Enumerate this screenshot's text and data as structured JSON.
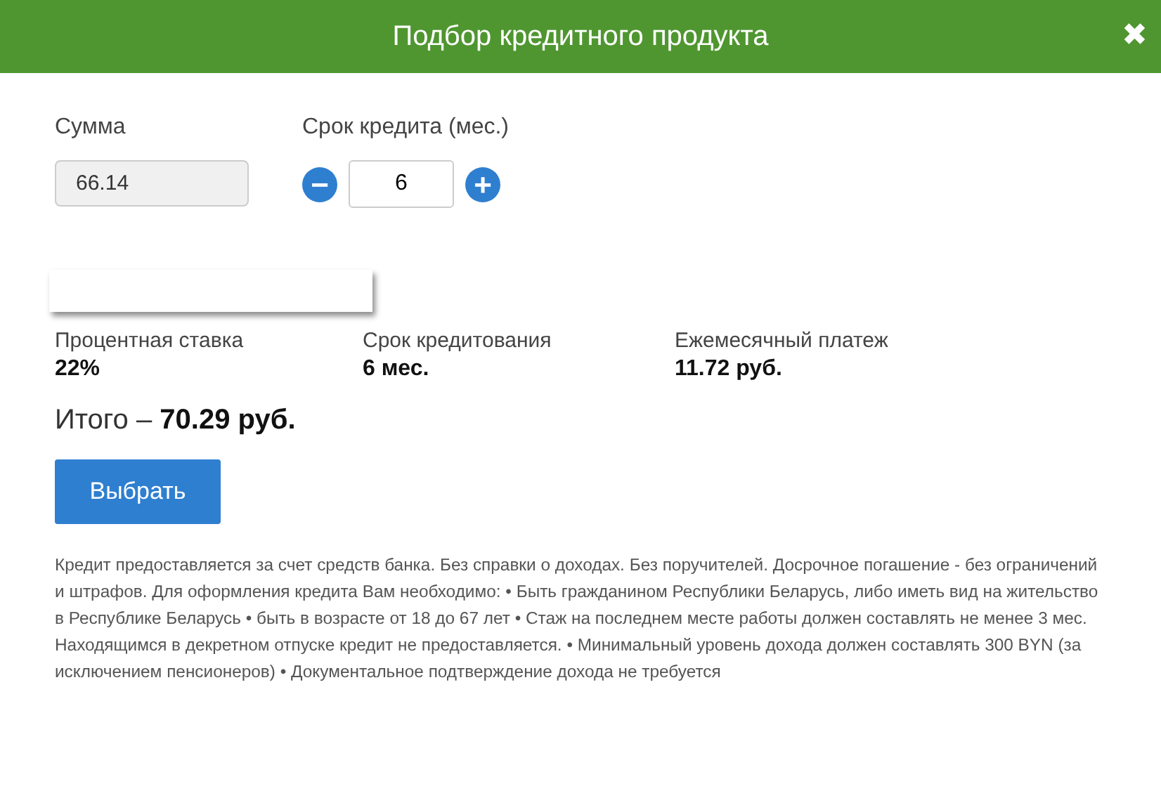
{
  "header": {
    "title": "Подбор кредитного продукта",
    "close": "✖"
  },
  "amount": {
    "label": "Сумма",
    "value": "66.14",
    "disabled": true
  },
  "term": {
    "label": "Срок кредита (мес.)",
    "value": "6",
    "minus": "−",
    "plus": "+"
  },
  "summary": [
    {
      "label": "Процентная ставка",
      "value": "22%"
    },
    {
      "label": "Срок кредитования",
      "value": "6 мес."
    },
    {
      "label": "Ежемесячный платеж",
      "value": "11.72 руб."
    }
  ],
  "total": "Итого – **70.29 руб.**",
  "select_button": "Выбрать",
  "disclaimer": "Кредит предоставляется за счет средств банка. Без справки о доходах. Без поручителей. Досрочное погашение - без ограничений и штрафов. Для оформления кредита Вам необходимо: • Быть гражданином Республики Беларусь, либо иметь вид на жительство в Республике Беларусь • быть в возрасте от 18 до 67 лет • Стаж на последнем месте работы должен составлять не менее 3 мес. Находящимся в декретном отпуске кредит не предоставляется. • Минимальный уровень дохода должен составлять 300 BYN (за исключением пенсионеров) • Документальное подтверждение дохода не требуется"
}
